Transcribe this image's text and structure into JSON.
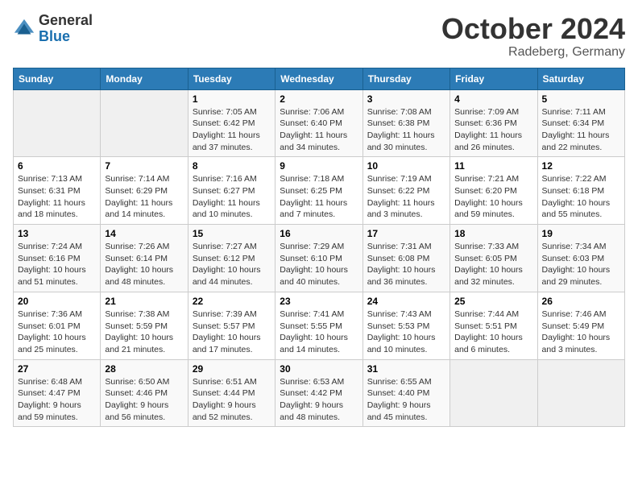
{
  "header": {
    "logo_general": "General",
    "logo_blue": "Blue",
    "title": "October 2024",
    "subtitle": "Radeberg, Germany"
  },
  "columns": [
    "Sunday",
    "Monday",
    "Tuesday",
    "Wednesday",
    "Thursday",
    "Friday",
    "Saturday"
  ],
  "weeks": [
    [
      {
        "day": "",
        "detail": ""
      },
      {
        "day": "",
        "detail": ""
      },
      {
        "day": "1",
        "detail": "Sunrise: 7:05 AM\nSunset: 6:42 PM\nDaylight: 11 hours\nand 37 minutes."
      },
      {
        "day": "2",
        "detail": "Sunrise: 7:06 AM\nSunset: 6:40 PM\nDaylight: 11 hours\nand 34 minutes."
      },
      {
        "day": "3",
        "detail": "Sunrise: 7:08 AM\nSunset: 6:38 PM\nDaylight: 11 hours\nand 30 minutes."
      },
      {
        "day": "4",
        "detail": "Sunrise: 7:09 AM\nSunset: 6:36 PM\nDaylight: 11 hours\nand 26 minutes."
      },
      {
        "day": "5",
        "detail": "Sunrise: 7:11 AM\nSunset: 6:34 PM\nDaylight: 11 hours\nand 22 minutes."
      }
    ],
    [
      {
        "day": "6",
        "detail": "Sunrise: 7:13 AM\nSunset: 6:31 PM\nDaylight: 11 hours\nand 18 minutes."
      },
      {
        "day": "7",
        "detail": "Sunrise: 7:14 AM\nSunset: 6:29 PM\nDaylight: 11 hours\nand 14 minutes."
      },
      {
        "day": "8",
        "detail": "Sunrise: 7:16 AM\nSunset: 6:27 PM\nDaylight: 11 hours\nand 10 minutes."
      },
      {
        "day": "9",
        "detail": "Sunrise: 7:18 AM\nSunset: 6:25 PM\nDaylight: 11 hours\nand 7 minutes."
      },
      {
        "day": "10",
        "detail": "Sunrise: 7:19 AM\nSunset: 6:22 PM\nDaylight: 11 hours\nand 3 minutes."
      },
      {
        "day": "11",
        "detail": "Sunrise: 7:21 AM\nSunset: 6:20 PM\nDaylight: 10 hours\nand 59 minutes."
      },
      {
        "day": "12",
        "detail": "Sunrise: 7:22 AM\nSunset: 6:18 PM\nDaylight: 10 hours\nand 55 minutes."
      }
    ],
    [
      {
        "day": "13",
        "detail": "Sunrise: 7:24 AM\nSunset: 6:16 PM\nDaylight: 10 hours\nand 51 minutes."
      },
      {
        "day": "14",
        "detail": "Sunrise: 7:26 AM\nSunset: 6:14 PM\nDaylight: 10 hours\nand 48 minutes."
      },
      {
        "day": "15",
        "detail": "Sunrise: 7:27 AM\nSunset: 6:12 PM\nDaylight: 10 hours\nand 44 minutes."
      },
      {
        "day": "16",
        "detail": "Sunrise: 7:29 AM\nSunset: 6:10 PM\nDaylight: 10 hours\nand 40 minutes."
      },
      {
        "day": "17",
        "detail": "Sunrise: 7:31 AM\nSunset: 6:08 PM\nDaylight: 10 hours\nand 36 minutes."
      },
      {
        "day": "18",
        "detail": "Sunrise: 7:33 AM\nSunset: 6:05 PM\nDaylight: 10 hours\nand 32 minutes."
      },
      {
        "day": "19",
        "detail": "Sunrise: 7:34 AM\nSunset: 6:03 PM\nDaylight: 10 hours\nand 29 minutes."
      }
    ],
    [
      {
        "day": "20",
        "detail": "Sunrise: 7:36 AM\nSunset: 6:01 PM\nDaylight: 10 hours\nand 25 minutes."
      },
      {
        "day": "21",
        "detail": "Sunrise: 7:38 AM\nSunset: 5:59 PM\nDaylight: 10 hours\nand 21 minutes."
      },
      {
        "day": "22",
        "detail": "Sunrise: 7:39 AM\nSunset: 5:57 PM\nDaylight: 10 hours\nand 17 minutes."
      },
      {
        "day": "23",
        "detail": "Sunrise: 7:41 AM\nSunset: 5:55 PM\nDaylight: 10 hours\nand 14 minutes."
      },
      {
        "day": "24",
        "detail": "Sunrise: 7:43 AM\nSunset: 5:53 PM\nDaylight: 10 hours\nand 10 minutes."
      },
      {
        "day": "25",
        "detail": "Sunrise: 7:44 AM\nSunset: 5:51 PM\nDaylight: 10 hours\nand 6 minutes."
      },
      {
        "day": "26",
        "detail": "Sunrise: 7:46 AM\nSunset: 5:49 PM\nDaylight: 10 hours\nand 3 minutes."
      }
    ],
    [
      {
        "day": "27",
        "detail": "Sunrise: 6:48 AM\nSunset: 4:47 PM\nDaylight: 9 hours\nand 59 minutes."
      },
      {
        "day": "28",
        "detail": "Sunrise: 6:50 AM\nSunset: 4:46 PM\nDaylight: 9 hours\nand 56 minutes."
      },
      {
        "day": "29",
        "detail": "Sunrise: 6:51 AM\nSunset: 4:44 PM\nDaylight: 9 hours\nand 52 minutes."
      },
      {
        "day": "30",
        "detail": "Sunrise: 6:53 AM\nSunset: 4:42 PM\nDaylight: 9 hours\nand 48 minutes."
      },
      {
        "day": "31",
        "detail": "Sunrise: 6:55 AM\nSunset: 4:40 PM\nDaylight: 9 hours\nand 45 minutes."
      },
      {
        "day": "",
        "detail": ""
      },
      {
        "day": "",
        "detail": ""
      }
    ]
  ]
}
